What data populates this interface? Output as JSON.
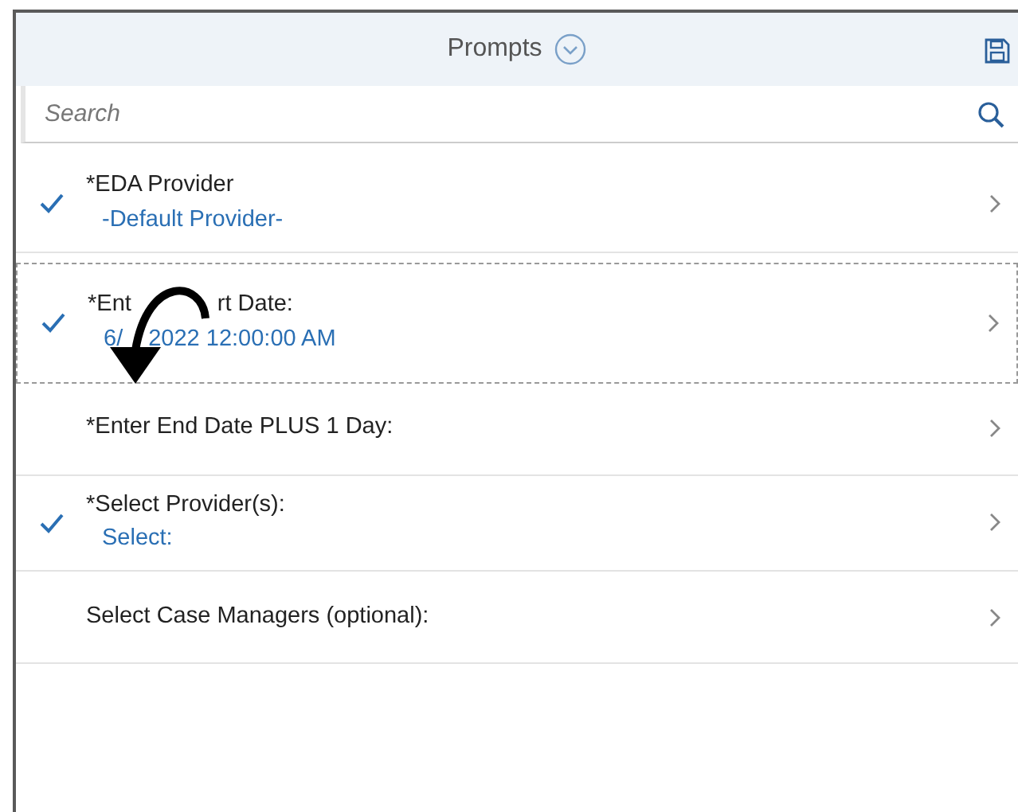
{
  "header": {
    "title": "Prompts"
  },
  "search": {
    "placeholder": "Search"
  },
  "prompts": [
    {
      "checked": true,
      "focused": false,
      "label": [
        "*EDA Provider"
      ],
      "value": [
        "-Default Provider-"
      ]
    },
    {
      "checked": true,
      "focused": true,
      "label": [
        "*Ent",
        "rt Date:"
      ],
      "value": [
        "6/",
        "2022 12:00:00 AM"
      ]
    },
    {
      "checked": false,
      "focused": false,
      "label": [
        "*Enter End Date PLUS 1 Day:"
      ]
    },
    {
      "checked": true,
      "focused": false,
      "label": [
        "*Select Provider(s):"
      ],
      "value": [
        "Select:"
      ]
    },
    {
      "checked": false,
      "focused": false,
      "label": [
        "Select Case Managers (optional):"
      ]
    }
  ],
  "annotation": {
    "kind": "curved-arrow"
  }
}
